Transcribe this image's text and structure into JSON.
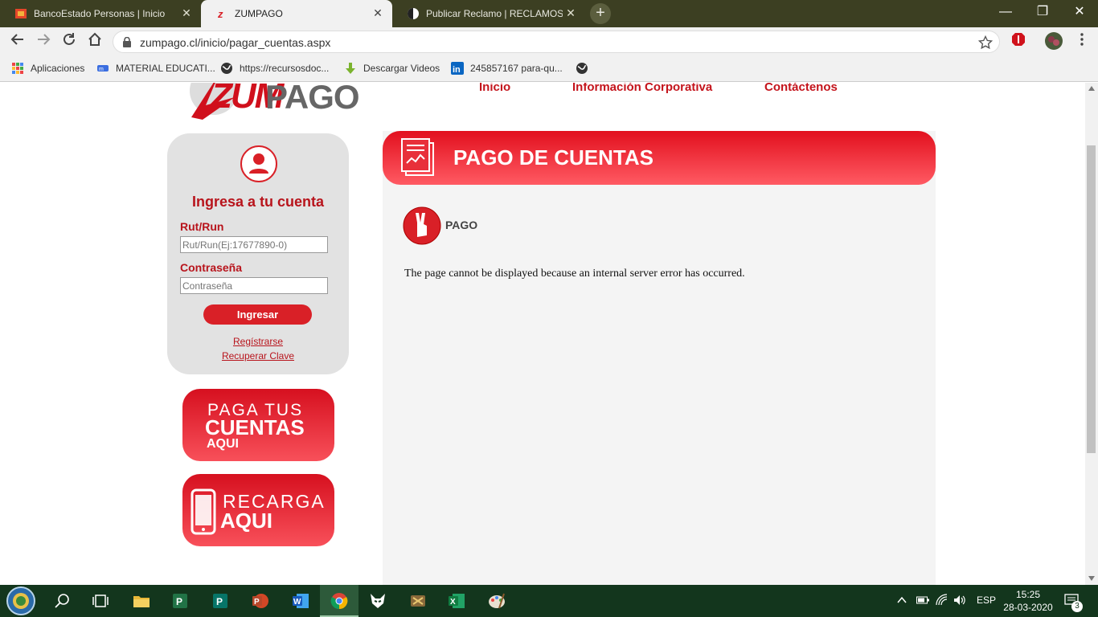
{
  "browser": {
    "tabs": [
      {
        "title": "BancoEstado Personas | Inicio",
        "active": false
      },
      {
        "title": "ZUMPAGO",
        "active": true
      },
      {
        "title": "Publicar Reclamo | RECLAMOS.CL",
        "active": false
      }
    ],
    "url": "zumpago.cl/inicio/pagar_cuentas.aspx",
    "bookmarks": [
      {
        "label": "Aplicaciones",
        "icon": "apps-grid-icon"
      },
      {
        "label": "MATERIAL EDUCATI...",
        "icon": "material-icon"
      },
      {
        "label": "https://recursosdoc...",
        "icon": "globe-icon"
      },
      {
        "label": "Descargar Videos",
        "icon": "download-leaf-icon"
      },
      {
        "label": "245857167 para-qu...",
        "icon": "linkedin-icon"
      },
      {
        "label": "",
        "icon": "globe-icon"
      }
    ]
  },
  "site": {
    "logo_text_zum": "ZUM",
    "logo_text_pago": "PAGO",
    "nav": [
      "Inicio",
      "Información Corporativa",
      "Contáctenos"
    ],
    "login": {
      "title": "Ingresa a tu cuenta",
      "rut_label": "Rut/Run",
      "rut_placeholder": "Rut/Run(Ej:17677890-0)",
      "password_label": "Contraseña",
      "password_placeholder": "Contraseña",
      "submit": "Ingresar",
      "register": "Regístrarse",
      "recover": "Recuperar Clave"
    },
    "promo_pay": {
      "line1": "PAGA TUS",
      "line2": "CUENTAS",
      "line3": "AQUI"
    },
    "promo_recharge": {
      "line1": "RECARGA",
      "line2": "AQUI"
    },
    "panel": {
      "title": "PAGO DE CUENTAS",
      "section": "PAGO",
      "error": "The page cannot be displayed because an internal server error has occurred."
    }
  },
  "taskbar": {
    "language": "ESP",
    "time": "15:25",
    "date": "28-03-2020",
    "notifications": "3"
  },
  "colors": {
    "brand_red": "#d92027",
    "tabstrip": "#3c3f22",
    "taskbar": "#13361d"
  }
}
